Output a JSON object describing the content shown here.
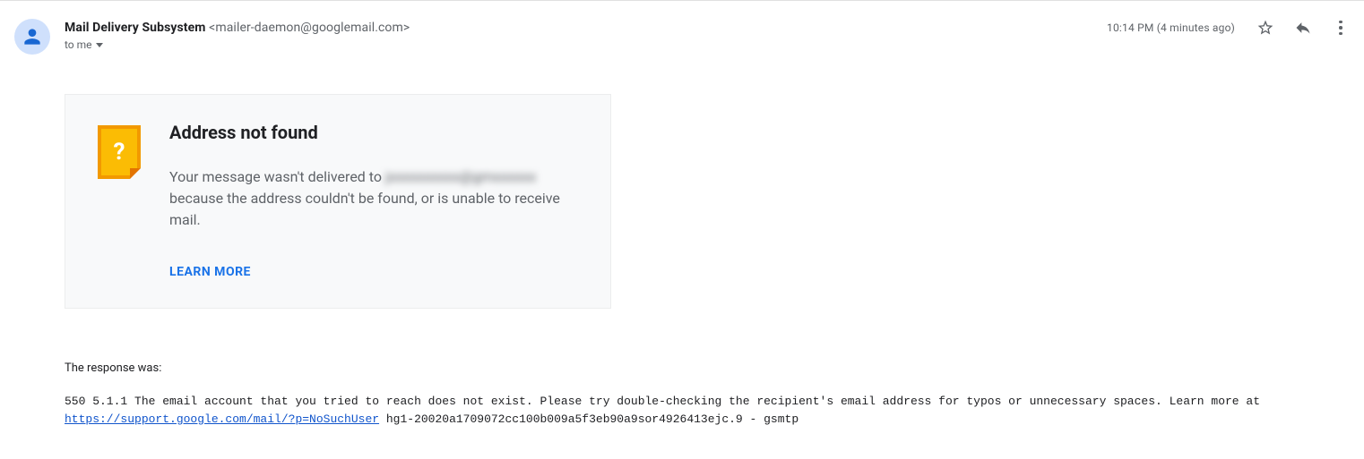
{
  "header": {
    "sender_name": "Mail Delivery Subsystem",
    "sender_email": "<mailer-daemon@googlemail.com>",
    "recipient_line": "to me",
    "timestamp": "10:14 PM (4 minutes ago)"
  },
  "card": {
    "title": "Address not found",
    "line1_prefix": "Your message wasn't delivered to ",
    "redacted_address": "jxxxxxxxxxx@gmxxxxxx",
    "line2": "because the address couldn't be found, or is unable to receive mail.",
    "learn_more": "LEARN MORE"
  },
  "response": {
    "label": "The response was:",
    "code_pre": "550 5.1.1 The email account that you tried to reach does not exist. Please try double-checking the recipient's email address for typos or unnecessary spaces. Learn more at ",
    "link_text": "https://support.google.com/mail/?p=NoSuchUser",
    "code_post": " hg1-20020a1709072cc100b009a5f3eb90a9sor4926413ejc.9 - gsmtp"
  }
}
